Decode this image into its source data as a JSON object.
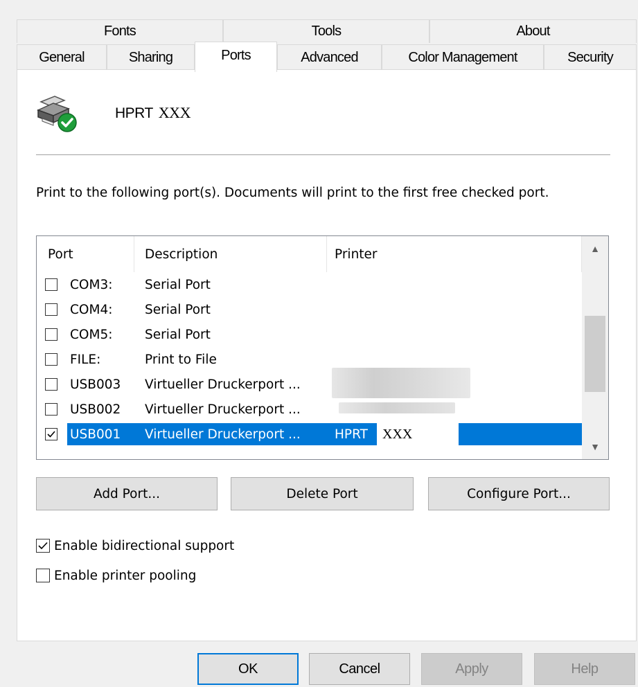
{
  "tabs_row1": [
    "Fonts",
    "Tools",
    "About"
  ],
  "tabs_row2": [
    "General",
    "Sharing",
    "Ports",
    "Advanced",
    "Color Management",
    "Security"
  ],
  "selected_tab": "Ports",
  "printer": {
    "name": "HPRT",
    "name_mask": "XXX",
    "icon": "printer-ready-icon"
  },
  "instructions": "Print to the following port(s). Documents will print to the first free checked port.",
  "ports_list": {
    "columns": [
      "Port",
      "Description",
      "Printer"
    ],
    "rows": [
      {
        "port": "COM3:",
        "description": "Serial Port",
        "printer": "",
        "checked": false
      },
      {
        "port": "COM4:",
        "description": "Serial Port",
        "printer": "",
        "checked": false
      },
      {
        "port": "COM5:",
        "description": "Serial Port",
        "printer": "",
        "checked": false
      },
      {
        "port": "FILE:",
        "description": "Print to File",
        "printer": "",
        "checked": false
      },
      {
        "port": "USB003",
        "description": "Virtueller Druckerport ...",
        "printer": "",
        "checked": false
      },
      {
        "port": "USB002",
        "description": "Virtueller Druckerport ...",
        "printer": "",
        "checked": false
      },
      {
        "port": "USB001",
        "description": "Virtueller Druckerport ...",
        "printer": "HPRT",
        "printer_mask": "XXX",
        "checked": true,
        "selected": true
      }
    ]
  },
  "buttons": {
    "add_port": "Add Port...",
    "delete_port": "Delete Port",
    "configure_port": "Configure Port..."
  },
  "options": {
    "bidirectional": {
      "label": "Enable bidirectional support",
      "checked": true
    },
    "pooling": {
      "label": "Enable printer pooling",
      "checked": false
    }
  },
  "footer": {
    "ok": "OK",
    "cancel": "Cancel",
    "apply": "Apply",
    "help": "Help"
  },
  "colors": {
    "selection": "#0078d7",
    "window_bg": "#f0f0f0",
    "status_ok": "#1f9e3b"
  }
}
